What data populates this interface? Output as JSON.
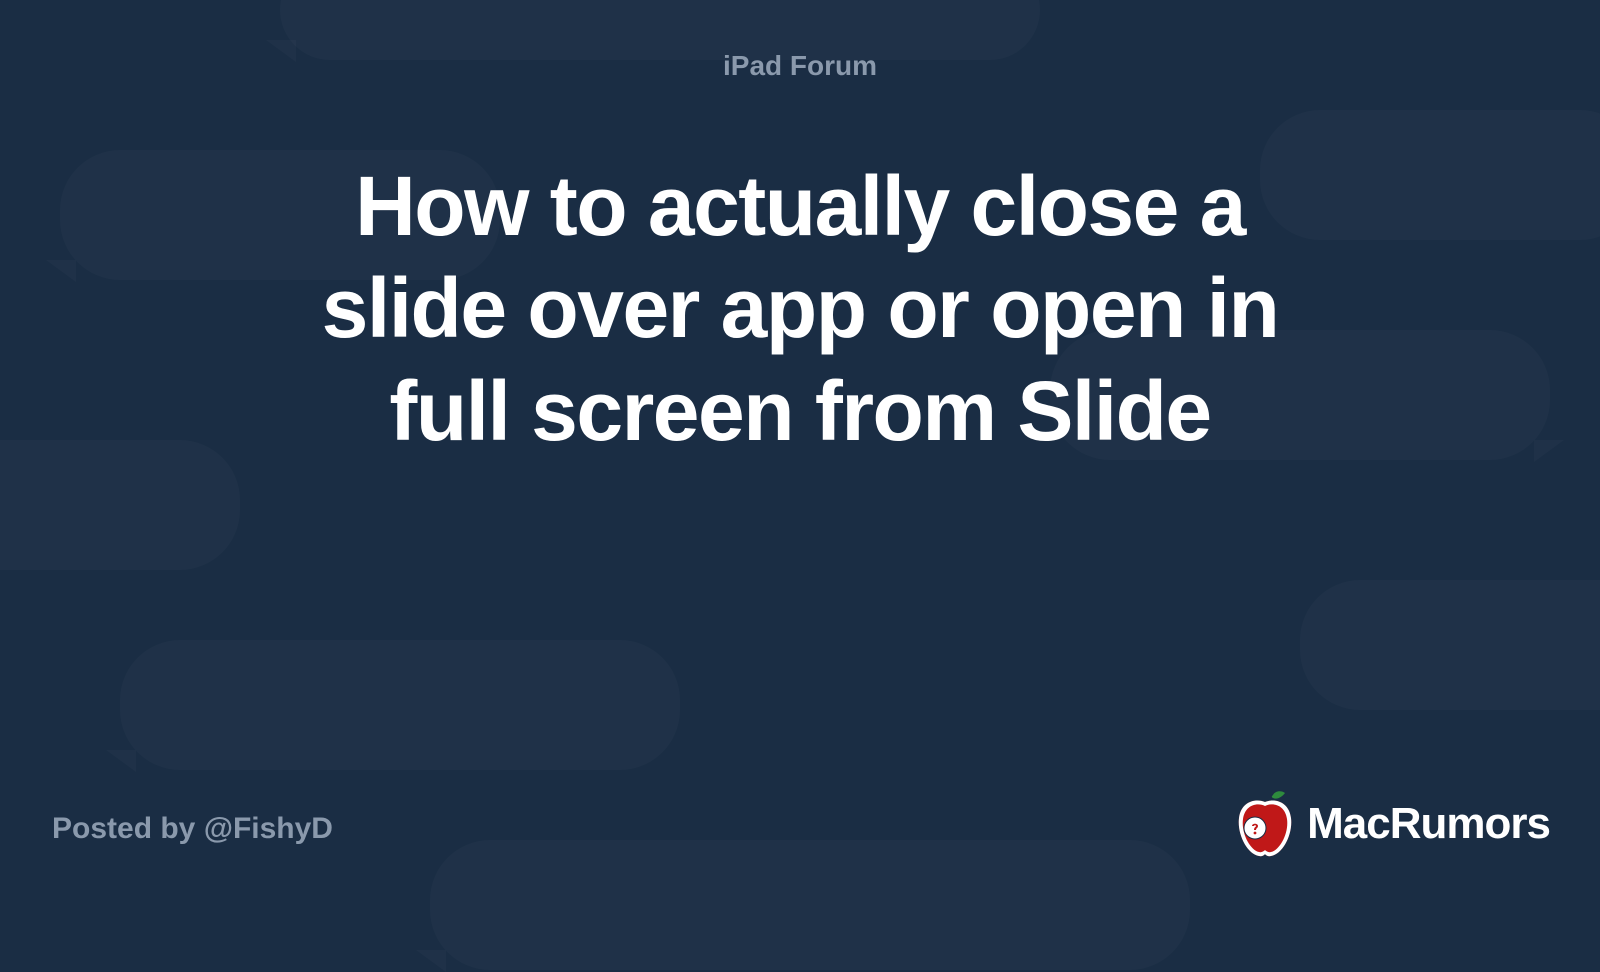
{
  "category": "iPad Forum",
  "title": "How to actually close a slide over app or open in full screen from Slide",
  "posted_by": "Posted by @FishyD",
  "brand": "MacRumors"
}
